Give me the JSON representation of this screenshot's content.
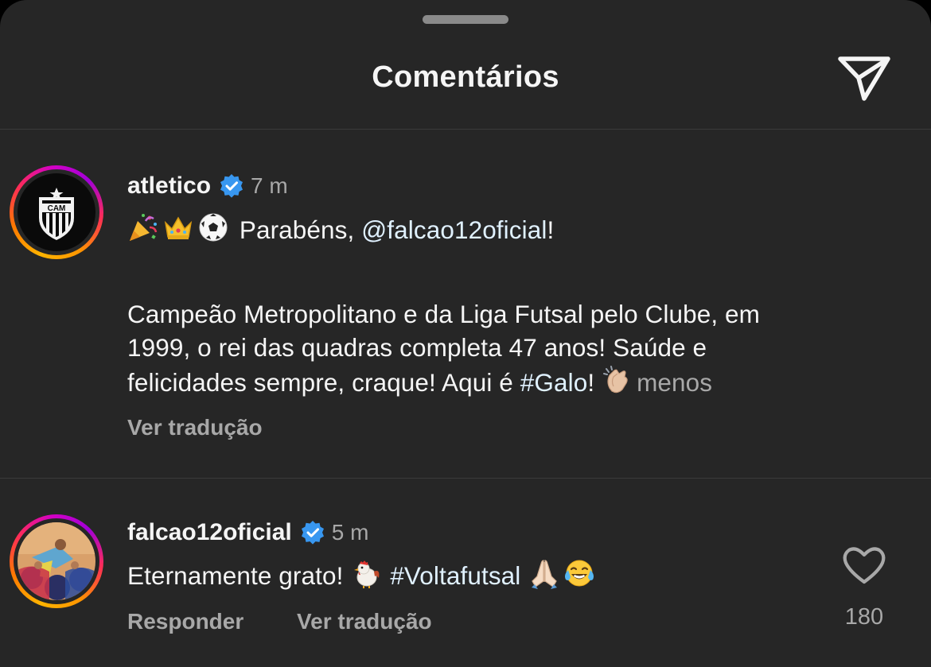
{
  "header": {
    "title": "Comentários",
    "share_icon": "paper-plane-icon"
  },
  "comments": [
    {
      "username": "atletico",
      "verified": true,
      "time": "7 m",
      "avatar": "atletico-crest-avatar",
      "avatar_label": "CAM",
      "line1_emojis": [
        "party-popper-emoji",
        "crown-emoji",
        "soccer-ball-emoji"
      ],
      "line1_text": "Parabéns, ",
      "line1_mention": "@falcao12oficial",
      "line1_end": "!",
      "body_line1": "Campeão Metropolitano e da Liga Futsal pelo Clube, em",
      "body_line2": "1999, o rei das quadras completa 47 anos! Saúde e",
      "body_line3_start": "felicidades sempre, craque! Aqui é ",
      "body_line3_hashtag": "#Galo",
      "body_line3_end": "! ",
      "body_line3_emoji": "clapping-hands-emoji",
      "less_label": "menos",
      "translate_label": "Ver tradução"
    },
    {
      "username": "falcao12oficial",
      "verified": true,
      "time": "5 m",
      "avatar": "falcao-photo-avatar",
      "text_start": "Eternamente grato! ",
      "emoji1": "rooster-emoji",
      "hashtag": "#Voltafutsal",
      "emoji2": "folded-hands-emoji",
      "emoji3": "tears-of-joy-emoji",
      "reply_label": "Responder",
      "translate_label": "Ver tradução",
      "like_icon": "heart-outline-icon",
      "like_count": "180"
    }
  ],
  "colors": {
    "background": "#262626",
    "text": "#f5f5f5",
    "muted": "#a8a8a8",
    "link": "#e0f1ff",
    "verified": "#3897f0"
  }
}
